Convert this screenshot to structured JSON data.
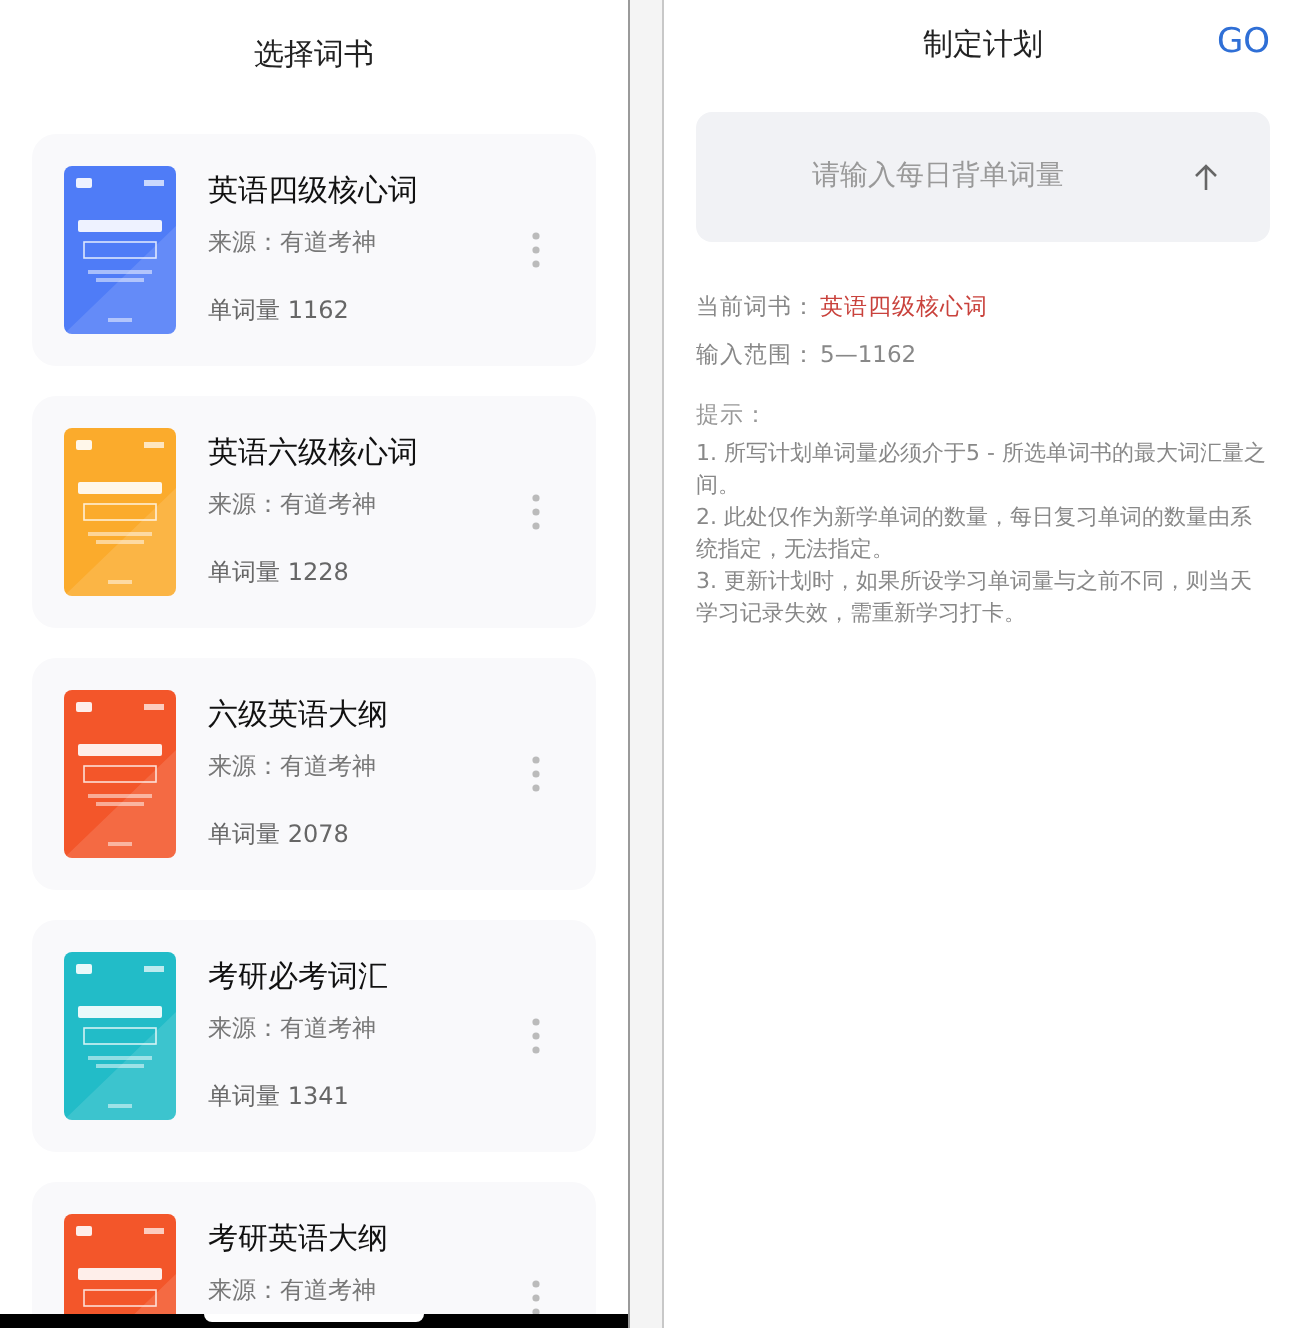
{
  "book_list": {
    "title": "选择词书",
    "books": [
      {
        "name": "英语四级核心词",
        "source": "来源：有道考神",
        "count": "单词量 1162"
      },
      {
        "name": "英语六级核心词",
        "source": "来源：有道考神",
        "count": "单词量 1228"
      },
      {
        "name": "六级英语大纲",
        "source": "来源：有道考神",
        "count": "单词量 2078"
      },
      {
        "name": "考研必考词汇",
        "source": "来源：有道考神",
        "count": "单词量 1341"
      },
      {
        "name": "考研英语大纲",
        "source": "来源：有道考神"
      }
    ]
  },
  "plan": {
    "title": "制定计划",
    "go": "GO",
    "input": {
      "placeholder": "请输入每日背单词量"
    },
    "current_book_label": "当前词书：",
    "current_book": "英语四级核心词",
    "range_label": "输入范围：",
    "range": "5—1162",
    "tips_title": "提示：",
    "tips": [
      "1. 所写计划单词量必须介于5 - 所选单词书的最大词汇量之间。",
      "2. 此处仅作为新学单词的数量，每日复习单词的数量由系统指定，无法指定。",
      "3. 更新计划时，如果所设学习单词量与之前不同，则当天学习记录失效，需重新学习打卡。"
    ]
  }
}
